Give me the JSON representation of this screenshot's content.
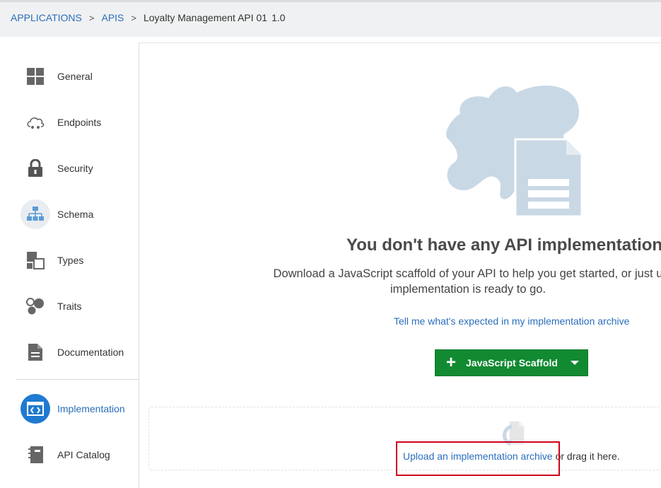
{
  "breadcrumb": {
    "applications": "APPLICATIONS",
    "apis": "APIS",
    "sep1": ">",
    "sep2": ">",
    "current": "Loyalty Management API 01",
    "version": "1.0"
  },
  "sidebar": {
    "items": [
      {
        "label": "General",
        "icon": "grid-icon"
      },
      {
        "label": "Endpoints",
        "icon": "cloud-icon"
      },
      {
        "label": "Security",
        "icon": "lock-icon"
      },
      {
        "label": "Schema",
        "icon": "hierarchy-icon"
      },
      {
        "label": "Types",
        "icon": "types-icon"
      },
      {
        "label": "Traits",
        "icon": "traits-icon"
      },
      {
        "label": "Documentation",
        "icon": "document-icon"
      },
      {
        "label": "Implementation",
        "icon": "code-icon",
        "active": true
      },
      {
        "label": "API Catalog",
        "icon": "catalog-icon"
      }
    ]
  },
  "main": {
    "title": "You don't have any API implementation",
    "description": "Download a JavaScript scaffold of your API to help you get started, or just u implementation is ready to go.",
    "help_link": "Tell me what's expected in my implementation archive",
    "scaffold_button": "JavaScript Scaffold",
    "upload_link": "Upload an implementation archive",
    "upload_suffix": " or drag it here."
  },
  "colors": {
    "accent": "#2a6ebb",
    "primary_button": "#118a32",
    "highlight": "#d0021b",
    "illustration": "#c9d8e5"
  }
}
